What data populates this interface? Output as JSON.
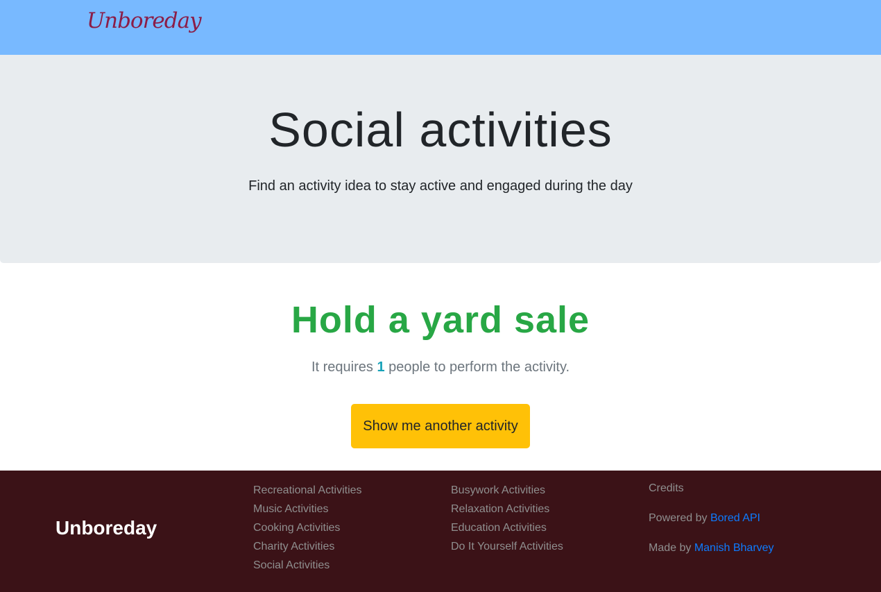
{
  "nav": {
    "logo": "Unboreday"
  },
  "hero": {
    "title": "Social activities",
    "subtitle": "Find an activity idea to stay active and engaged during the day"
  },
  "activity": {
    "name": "Hold a yard sale",
    "requires_prefix": "It requires",
    "participants": "1",
    "requires_suffix": "people to perform the activity.",
    "button_label": "Show me another activity"
  },
  "footer": {
    "brand": "Unboreday",
    "column1": [
      "Recreational Activities",
      "Music Activities",
      "Cooking Activities",
      "Charity Activities",
      "Social Activities"
    ],
    "column2": [
      "Busywork Activities",
      "Relaxation Activities",
      "Education Activities",
      "Do It Yourself Activities"
    ],
    "credits_label": "Credits",
    "powered_prefix": "Powered by",
    "powered_link": "Bored API",
    "made_prefix": "Made by",
    "made_link": "Manish Bharvey"
  },
  "colors": {
    "navbar": "#78b9ff",
    "jumbotron": "#e8ecef",
    "activity_title": "#28a745",
    "participants": "#17a2b8",
    "button": "#ffc107",
    "footer": "#3b1217",
    "footer_link": "#0d7bff"
  }
}
